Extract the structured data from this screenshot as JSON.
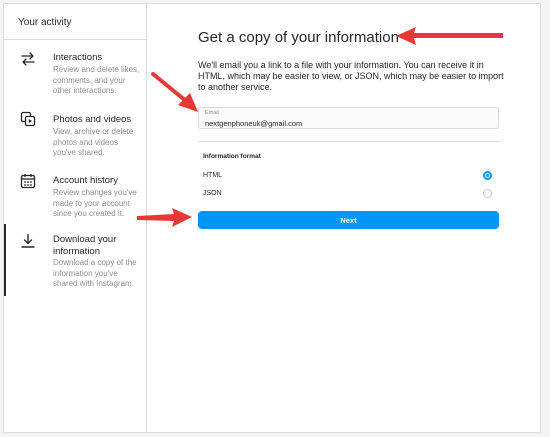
{
  "sidebar": {
    "header": "Your activity",
    "items": [
      {
        "title": "Interactions",
        "description": "Review and delete likes, comments, and your other interactions.",
        "icon": "arrows-swap-icon"
      },
      {
        "title": "Photos and videos",
        "description": "View, archive or delete photos and videos you've shared.",
        "icon": "photos-videos-icon"
      },
      {
        "title": "Account history",
        "description": "Review changes you've made to your account since you created it.",
        "icon": "calendar-icon"
      },
      {
        "title": "Download your information",
        "description": "Download a copy of the information you've shared with Instagram.",
        "icon": "download-icon",
        "active": true
      }
    ]
  },
  "main": {
    "title": "Get a copy of your information",
    "description": "We'll email you a link to a file with your information. You can receive it in HTML, which may be easier to view, or JSON, which may be easier to import to another service.",
    "email": {
      "label": "Email",
      "value": "nextgenphoneuk@gmail.com"
    },
    "format": {
      "heading": "Information format",
      "options": [
        {
          "label": "HTML",
          "selected": true
        },
        {
          "label": "JSON",
          "selected": false
        }
      ]
    },
    "next_label": "Next"
  },
  "colors": {
    "accent": "#0095f6",
    "annotation_arrow": "#e53935",
    "border": "#dbdbdb",
    "muted_text": "#8e8e8e"
  }
}
